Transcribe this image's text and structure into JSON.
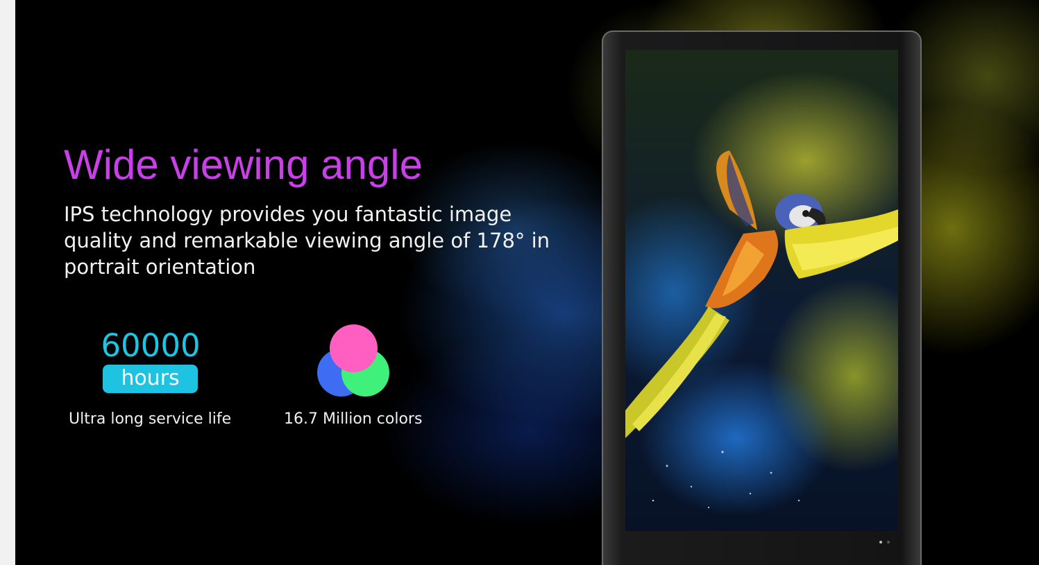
{
  "hero": {
    "headline": "Wide viewing angle",
    "description": "IPS technology provides you fantastic image quality and remarkable viewing angle of 178° in portrait orientation"
  },
  "features": [
    {
      "number": "60000",
      "unit": "hours",
      "caption": "Ultra long service life"
    },
    {
      "icon": "rgb-circles-icon",
      "caption": "16.7 Million colors"
    }
  ],
  "colors": {
    "headline": "#c93fe8",
    "accent_cyan": "#1dc3e1",
    "circle_pink": "#ff5fc0",
    "circle_green": "#3ff07a",
    "circle_blue": "#3e6cf2"
  },
  "device": {
    "active_page": 1,
    "page_count": 2
  }
}
